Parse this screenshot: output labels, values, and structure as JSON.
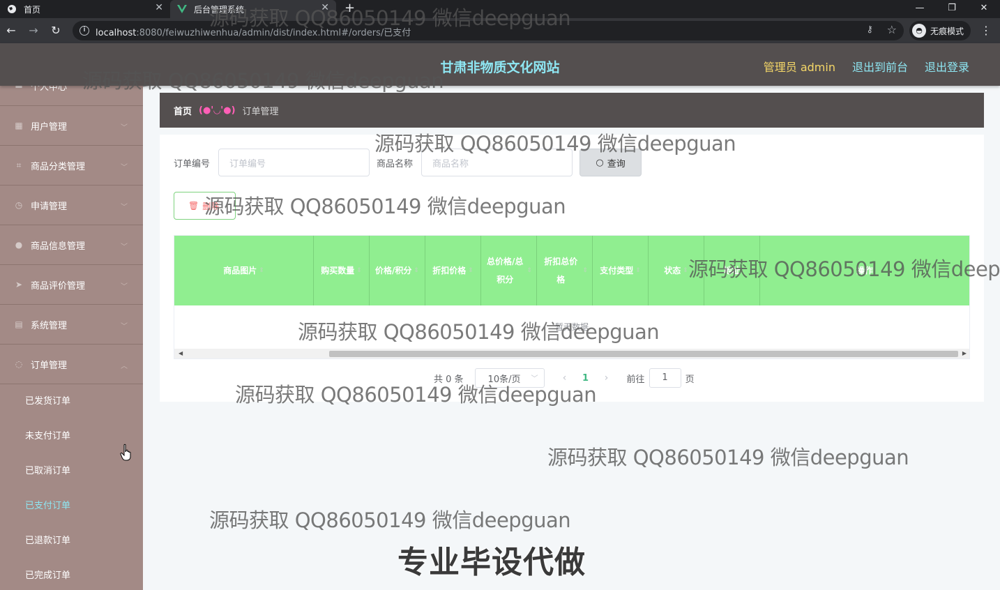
{
  "browser": {
    "tabs": [
      {
        "title": "首页",
        "active": false
      },
      {
        "title": "后台管理系统",
        "active": true
      }
    ],
    "url_host": "localhost",
    "url_rest": ":8080/feiwuzhiwenhua/admin/dist/index.html#/orders/已支付",
    "incognito_label": "无痕模式"
  },
  "header": {
    "site_title": "甘肃非物质文化网站",
    "user_label": "管理员 admin",
    "to_front": "退出到前台",
    "logout": "退出登录"
  },
  "sidebar": {
    "items": [
      {
        "label": "个人中心",
        "icon": "person-icon"
      },
      {
        "label": "用户管理",
        "icon": "grid-icon"
      },
      {
        "label": "商品分类管理",
        "icon": "crop-icon"
      },
      {
        "label": "申请管理",
        "icon": "clock-icon"
      },
      {
        "label": "商品信息管理",
        "icon": "user-icon"
      },
      {
        "label": "商品评价管理",
        "icon": "send-icon"
      },
      {
        "label": "系统管理",
        "icon": "doc-icon"
      },
      {
        "label": "订单管理",
        "icon": "circle-icon"
      }
    ],
    "sub_items": [
      {
        "label": "已发货订单",
        "active": false
      },
      {
        "label": "未支付订单",
        "active": false
      },
      {
        "label": "已取消订单",
        "active": false
      },
      {
        "label": "已支付订单",
        "active": true
      },
      {
        "label": "已退款订单",
        "active": false
      },
      {
        "label": "已完成订单",
        "active": false
      }
    ]
  },
  "breadcrumb": {
    "home": "首页",
    "separator": "(●'◡'●)",
    "current": "订单管理"
  },
  "search": {
    "order_no_label": "订单编号",
    "order_no_placeholder": "订单编号",
    "goods_name_label": "商品名称",
    "goods_name_placeholder": "商品名称",
    "query_button": "查询"
  },
  "toolbar": {
    "delete_button": "删除"
  },
  "table": {
    "columns": [
      {
        "label": "商品图片"
      },
      {
        "label": "购买数量"
      },
      {
        "label": "价格/积分"
      },
      {
        "label": "折扣价格"
      },
      {
        "label": "总价格/总积分"
      },
      {
        "label": "折扣总价格"
      },
      {
        "label": "支付类型"
      },
      {
        "label": "状态"
      },
      {
        "label": "地址"
      },
      {
        "label": "操作"
      }
    ],
    "empty_text": "暂无数据"
  },
  "pagination": {
    "total_text": "共 0 条",
    "page_size": "10条/页",
    "current_page": "1",
    "goto_label": "前往",
    "goto_value": "1",
    "page_unit": "页"
  },
  "watermarks": {
    "text": "源码获取 QQ86050149 微信deepguan",
    "big": "专业毕设代做"
  }
}
